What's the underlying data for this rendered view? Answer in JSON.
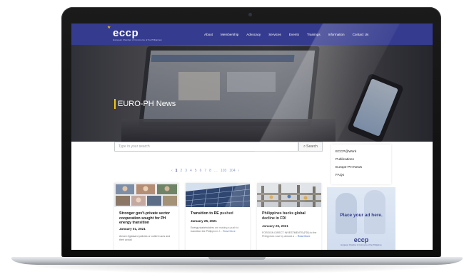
{
  "site": {
    "logo": "eccp",
    "logo_tagline": "European Chamber of Commerce of the Philippines"
  },
  "nav": {
    "items": [
      "About",
      "Membership",
      "Advocacy",
      "Services",
      "Events",
      "Trainings",
      "Information",
      "Contact Us"
    ]
  },
  "hero": {
    "title": "EURO-PH News"
  },
  "search": {
    "placeholder": "Type in your search",
    "button_label": "Search"
  },
  "pagination": {
    "prev": "‹",
    "pages": [
      "1",
      "2",
      "3",
      "4",
      "5",
      "6",
      "7",
      "8"
    ],
    "ellipsis": "…",
    "last_pages": [
      "103",
      "104"
    ],
    "next": "›",
    "active_page": "1"
  },
  "articles": [
    {
      "title": "Stronger gov't-private sector cooperation sought for PH energy transition",
      "date": "January 01, 2021",
      "excerpt": "Amonn ligislaard policies or outlent uses and their actual"
    },
    {
      "title": "Transition to RE pushed",
      "date": "January 25, 2021",
      "excerpt": "Energy stakeholders are making a push to transition the Philippines f...",
      "read_more": "Read More"
    },
    {
      "title": "Philippines bucks global decline in FDI",
      "date": "January 26, 2021",
      "excerpt": "FOREIGN DIRECT INVESTMENTS (FDI) to the Philippines rose by almost a ...",
      "read_more": "Read More"
    }
  ],
  "sidebar": {
    "links": [
      "ECCP@Work",
      "Publications",
      "Europe-PH News",
      "FAQs"
    ]
  },
  "ad": {
    "text": "Place your ad here.",
    "logo": "eccp"
  },
  "colors": {
    "nav_bg": "#353b8e",
    "accent": "#f2c417",
    "link": "#3c68b5"
  }
}
